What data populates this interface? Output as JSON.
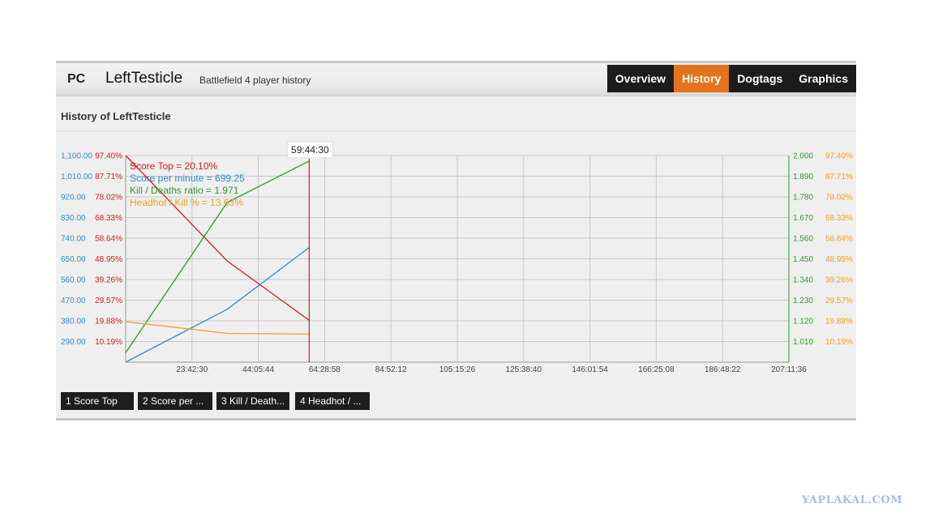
{
  "header": {
    "platform": "PC",
    "player_name": "LeftTesticle",
    "subtitle": "Battlefield 4 player history",
    "nav": [
      {
        "label": "Overview",
        "active": false
      },
      {
        "label": "History",
        "active": true
      },
      {
        "label": "Dogtags",
        "active": false
      },
      {
        "label": "Graphics",
        "active": false
      }
    ]
  },
  "section": {
    "title": "History of LeftTesticle"
  },
  "tooltip": {
    "time": "59:44:30",
    "lines": [
      {
        "text": "Score Top = 20.10%",
        "color": "#cc1f1f"
      },
      {
        "text": "Score per minute = 699.25",
        "color": "#2a90c8"
      },
      {
        "text": "Kill / Deaths ratio = 1.971",
        "color": "#2a9d2a"
      },
      {
        "text": "Headhot / Kill % = 13.63%",
        "color": "#f0a020"
      }
    ]
  },
  "chart_data": {
    "type": "line",
    "x_labels": [
      "23:42:30",
      "44:05:44",
      "64:28:58",
      "84:52:12",
      "105:15:26",
      "125:38:40",
      "146:01:54",
      "166:25:08",
      "186:48:22",
      "207:11:36"
    ],
    "x_label_hours": [
      23.708,
      44.096,
      64.483,
      84.869,
      105.257,
      125.644,
      146.032,
      166.419,
      186.806,
      207.193
    ],
    "xlim_hours": [
      3.32,
      207.193
    ],
    "y_axes": {
      "score_per_minute": {
        "labels": [
          "1,100.00",
          "1,010.00",
          "920.00",
          "830.00",
          "740.00",
          "650.00",
          "560.00",
          "470.00",
          "380.00",
          "290.00"
        ],
        "ylim": [
          200,
          1100
        ],
        "color": "#2a90c8"
      },
      "score_top_pct": {
        "labels": [
          "97.40%",
          "87.71%",
          "78.02%",
          "68.33%",
          "58.64%",
          "48.95%",
          "39.26%",
          "29.57%",
          "19.88%",
          "10.19%"
        ],
        "ylim": [
          0.5,
          97.4
        ],
        "color": "#cc1f1f"
      },
      "kd_ratio": {
        "labels": [
          "2.000",
          "1.890",
          "1.780",
          "1.670",
          "1.560",
          "1.450",
          "1.340",
          "1.230",
          "1.120",
          "1.010"
        ],
        "ylim": [
          0.9,
          2.0
        ],
        "color": "#2a9d2a"
      },
      "headshot_pct": {
        "labels": [
          "97.40%",
          "87.71%",
          "78.02%",
          "68.33%",
          "58.64%",
          "48.95%",
          "39.26%",
          "29.57%",
          "19.88%",
          "10.19%"
        ],
        "ylim": [
          0.5,
          97.4
        ],
        "color": "#f0a020"
      }
    },
    "grid": true,
    "cursor_hours": 59.742,
    "series": [
      {
        "name": "Score Top",
        "axis": "score_top_pct",
        "color": "#cc1f1f",
        "x_hours": [
          3.32,
          34.5,
          59.742
        ],
        "y": [
          97.4,
          48.0,
          20.1
        ]
      },
      {
        "name": "Score per minute",
        "axis": "score_per_minute",
        "color": "#2a90c8",
        "x_hours": [
          3.32,
          34.5,
          59.742
        ],
        "y": [
          200,
          430,
          699.25
        ]
      },
      {
        "name": "Kill / Deaths ratio",
        "axis": "kd_ratio",
        "color": "#2a9d2a",
        "x_hours": [
          3.32,
          34.5,
          59.742
        ],
        "y": [
          0.95,
          1.75,
          1.971
        ]
      },
      {
        "name": "Headhot / Kill %",
        "axis": "headshot_pct",
        "color": "#f0a020",
        "x_hours": [
          3.32,
          34.5,
          59.742
        ],
        "y": [
          19.5,
          14.0,
          13.63
        ]
      }
    ]
  },
  "legend_buttons": [
    "1 Score Top",
    "2 Score per ...",
    "3 Kill / Death...",
    "4 Headhot / ..."
  ],
  "watermark": "YAPLAKAL.COM"
}
